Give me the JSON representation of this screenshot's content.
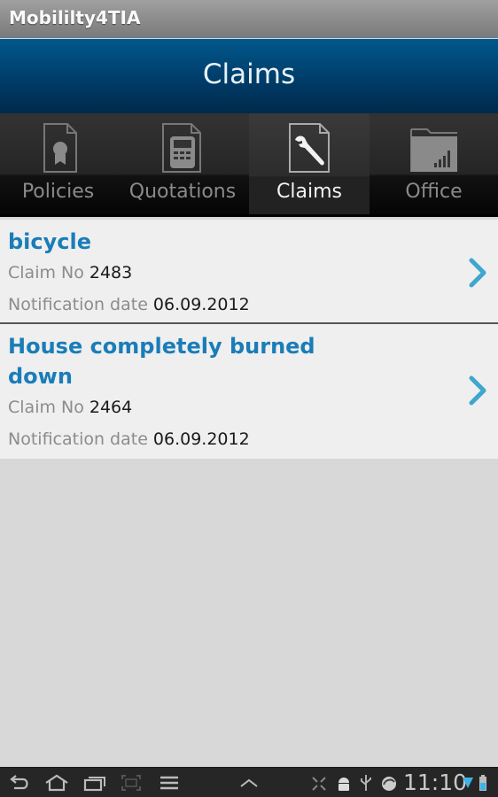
{
  "app": {
    "title": "Mobililty4TIA"
  },
  "header": {
    "title": "Claims"
  },
  "tabs": [
    {
      "label": "Policies",
      "icon": "certificate-document-icon",
      "active": false
    },
    {
      "label": "Quotations",
      "icon": "calculator-document-icon",
      "active": false
    },
    {
      "label": "Claims",
      "icon": "wrench-document-icon",
      "active": true
    },
    {
      "label": "Office",
      "icon": "folder-chart-icon",
      "active": false
    }
  ],
  "claims": [
    {
      "title": "bicycle",
      "claim_no_label": "Claim No",
      "claim_no": "2483",
      "date_label": "Notification date",
      "date": "06.09.2012"
    },
    {
      "title": "House completely burned down",
      "claim_no_label": "Claim No",
      "claim_no": "2464",
      "date_label": "Notification date",
      "date": "06.09.2012"
    }
  ],
  "statusbar": {
    "time": "11:10",
    "icons": [
      "back-icon",
      "home-icon",
      "recent-apps-icon",
      "screenshot-icon",
      "menu-icon",
      "up-chevron-icon",
      "fullscreen-icon",
      "android-debug-icon",
      "usb-icon",
      "sync-icon",
      "wifi-icon",
      "battery-icon"
    ]
  },
  "colors": {
    "accent": "#1a7db8",
    "header": "#003a66"
  }
}
